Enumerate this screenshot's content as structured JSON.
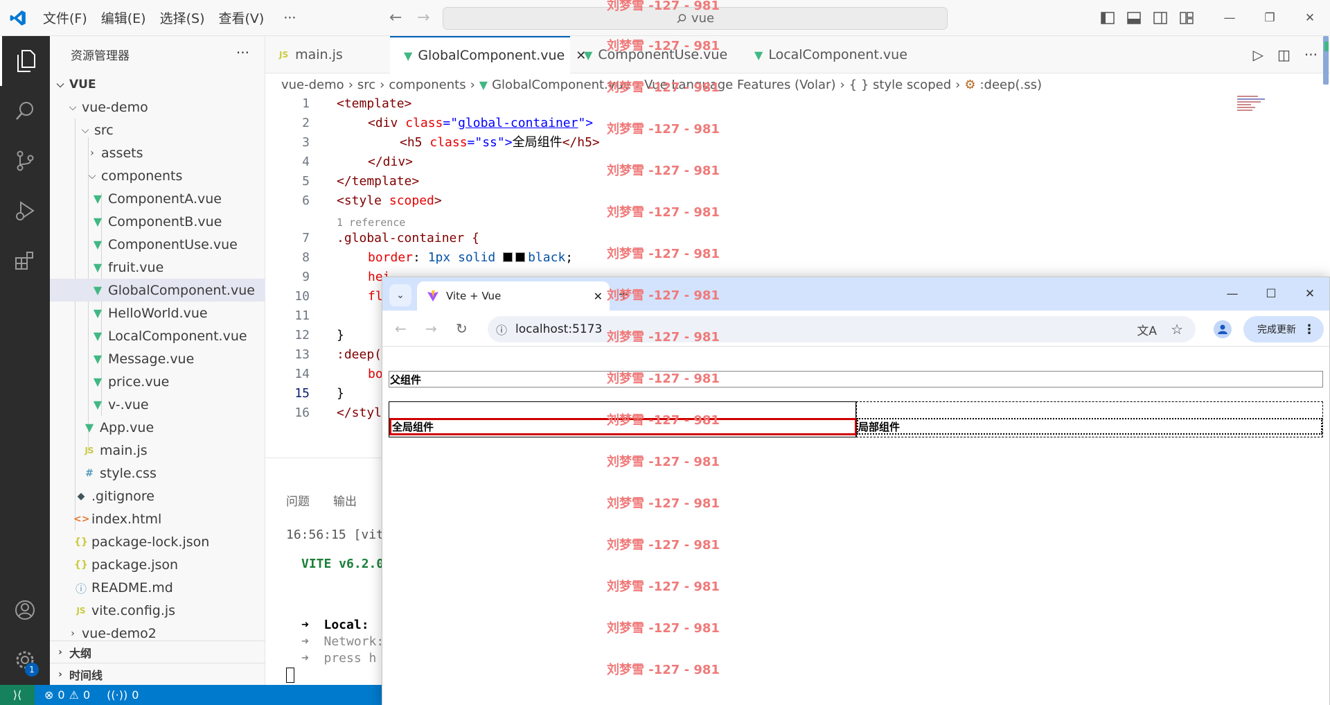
{
  "titlebar": {
    "menus": [
      "文件(F)",
      "编辑(E)",
      "选择(S)",
      "查看(V)"
    ],
    "more": "···",
    "search_text": "vue"
  },
  "sidebar": {
    "title": "资源管理器",
    "more": "···",
    "root": "VUE",
    "tree": [
      {
        "label": "vue-demo",
        "kind": "folder-open"
      },
      {
        "label": "src",
        "kind": "folder-open"
      },
      {
        "label": "assets",
        "kind": "folder-closed"
      },
      {
        "label": "components",
        "kind": "folder-open"
      },
      {
        "label": "ComponentA.vue",
        "kind": "vue"
      },
      {
        "label": "ComponentB.vue",
        "kind": "vue"
      },
      {
        "label": "ComponentUse.vue",
        "kind": "vue"
      },
      {
        "label": "fruit.vue",
        "kind": "vue"
      },
      {
        "label": "GlobalComponent.vue",
        "kind": "vue",
        "selected": true
      },
      {
        "label": "HelloWorld.vue",
        "kind": "vue"
      },
      {
        "label": "LocalComponent.vue",
        "kind": "vue"
      },
      {
        "label": "Message.vue",
        "kind": "vue"
      },
      {
        "label": "price.vue",
        "kind": "vue"
      },
      {
        "label": "v-.vue",
        "kind": "vue"
      },
      {
        "label": "App.vue",
        "kind": "vue"
      },
      {
        "label": "main.js",
        "kind": "js"
      },
      {
        "label": "style.css",
        "kind": "css"
      },
      {
        "label": ".gitignore",
        "kind": "git"
      },
      {
        "label": "index.html",
        "kind": "html"
      },
      {
        "label": "package-lock.json",
        "kind": "json"
      },
      {
        "label": "package.json",
        "kind": "json"
      },
      {
        "label": "README.md",
        "kind": "info"
      },
      {
        "label": "vite.config.js",
        "kind": "js"
      },
      {
        "label": "vue-demo2",
        "kind": "folder-closed"
      }
    ],
    "outline": "大纲",
    "timeline": "时间线"
  },
  "tabs": [
    {
      "label": "main.js",
      "icon": "JS"
    },
    {
      "label": "GlobalComponent.vue",
      "active": true
    },
    {
      "label": "ComponentUse.vue"
    },
    {
      "label": "LocalComponent.vue"
    }
  ],
  "breadcrumbs": [
    "vue-demo",
    "src",
    "components",
    "GlobalComponent.vue",
    "Vue Language Features (Volar)",
    "{ } style scoped",
    ":deep(.ss)"
  ],
  "code": {
    "line_numbers": [
      "1",
      "2",
      "3",
      "4",
      "5",
      "6",
      "7",
      "8",
      "9",
      "10",
      "11",
      "12",
      "13",
      "14",
      "15",
      "16"
    ],
    "codelens": "1 reference",
    "l1": "<template>",
    "l2a": "<div ",
    "l2b": "class",
    "l2c": "=\"",
    "l2d": "global-container",
    "l2e": "\">",
    "l3a": "<h5 ",
    "l3b": "class",
    "l3c": "=\"ss\">",
    "l3d": "全局组件",
    "l3e": "</h5>",
    "l4": "</div>",
    "l5": "</template>",
    "l6a": "<style ",
    "l6b": "scoped",
    "l6c": ">",
    "l7": ".global-container {",
    "l8a": "border",
    "l8b": ": ",
    "l8c": "1px solid ",
    "l8d": "black",
    "l8e": ";",
    "l9": "hei",
    "l10": "fl",
    "l12": "}",
    "l13": ":deep(",
    "l14": "bo",
    "l15": "}",
    "l16": "</styl"
  },
  "panel": {
    "tabs": [
      "问题",
      "输出"
    ],
    "terminal": [
      "16:56:15 [vit",
      "VITE v6.2.0",
      "➜  Local:",
      "➜  Network:",
      "➜  press h"
    ]
  },
  "statusbar": {
    "errors": "0",
    "warnings": "0",
    "ports": "0",
    "badge": "1"
  },
  "browser": {
    "tab_title": "Vite + Vue",
    "url": "localhost:5173",
    "update_label": "完成更新",
    "parent_label": "父组件",
    "global_label": "全局组件",
    "local_label": "局部组件",
    "colors": {
      "highlight_border": "#d00000"
    }
  },
  "watermark": "刘梦雪 -127 - 981"
}
